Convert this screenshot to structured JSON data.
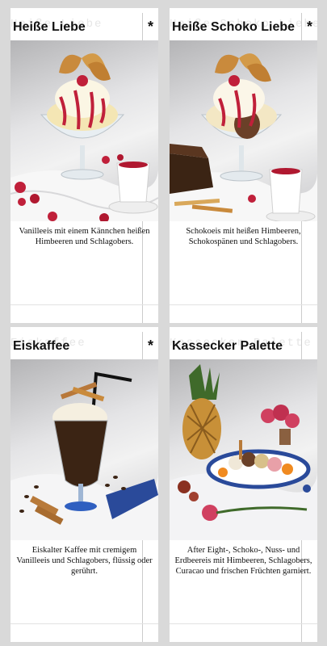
{
  "cards": [
    {
      "title": "Heiße Liebe",
      "ghost_title": "Heiße Liebe",
      "marker": "*",
      "photo_icon": "ice-cream-sundae-with-raspberries",
      "description": "Vanilleeis mit einem Kännchen heißen Himbeeren und Schlagobers."
    },
    {
      "title": "Heiße Schoko Liebe",
      "ghost_title": "Heiße Schoko Liebe",
      "marker": "*",
      "photo_icon": "chocolate-sundae-with-raspberries",
      "description": "Schokoeis mit heißen Himbeeren, Schokospänen und Schlagobers."
    },
    {
      "title": "Eiskaffee",
      "ghost_title": "Eiskaffee",
      "marker": "*",
      "photo_icon": "iced-coffee-glass-with-straw",
      "description": "Eiskalter Kaffee mit cremigem Vanilleeis und Schlagobers, flüssig oder gerührt."
    },
    {
      "title": "Kassecker Palette",
      "ghost_title": "Kassecker Palette",
      "marker": "",
      "photo_icon": "ice-cream-platter-with-pineapple",
      "description": "After Eight-, Schoko-, Nuss- und Erdbeereis mit Himbeeren, Schlagobers, Curacao und frischen Früchten garniert."
    }
  ],
  "colors": {
    "background": "#d9d9d9",
    "card": "#ffffff",
    "raspberry": "#c0203a",
    "waffle": "#c98a3c",
    "coffee": "#3b2414"
  }
}
